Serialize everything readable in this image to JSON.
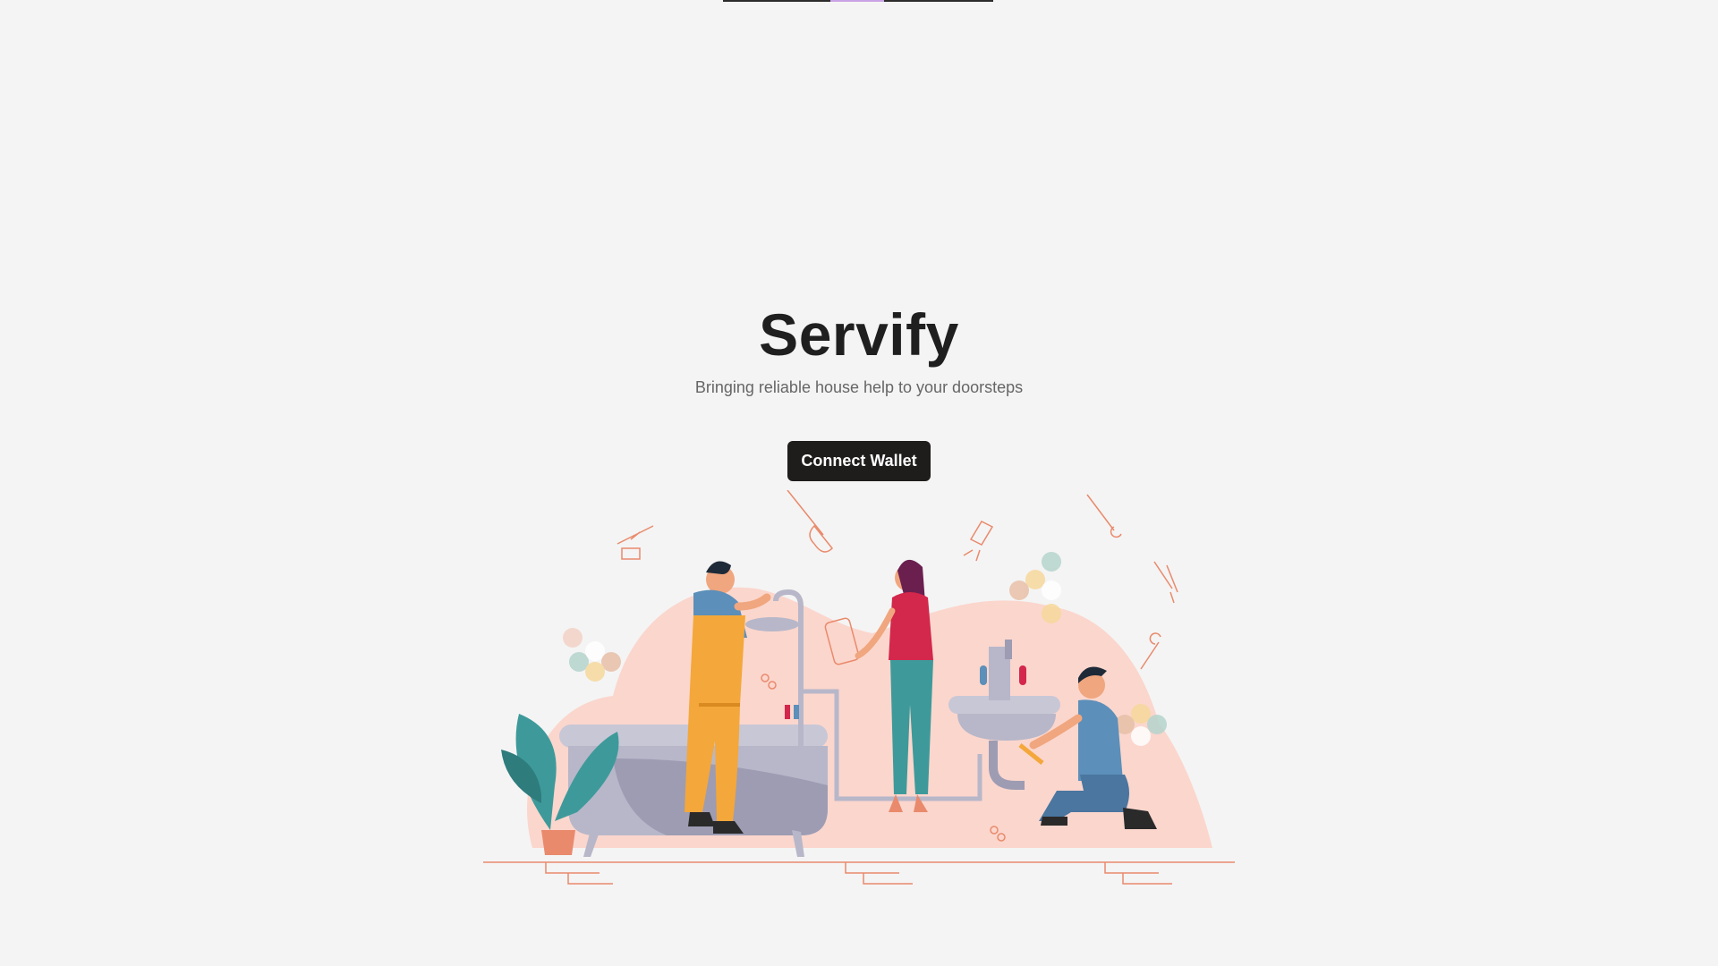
{
  "app": {
    "title": "Servify",
    "tagline": "Bringing reliable house help to your doorsteps"
  },
  "actions": {
    "connect_wallet_label": "Connect Wallet"
  },
  "illustration": {
    "subject": "plumbers-fixing-bathroom",
    "icons": [
      "wrench-icon",
      "plunger-icon",
      "pliers-icon",
      "faucet-icon",
      "phone-icon"
    ],
    "colors": {
      "blob": "#fbd6cd",
      "line": "#e98a6c",
      "tub": "#b7b7c9",
      "plant": "#3e9a9a",
      "accent_yellow": "#f4a73a",
      "accent_red": "#d3274c",
      "accent_blue": "#5c8fb9"
    }
  }
}
